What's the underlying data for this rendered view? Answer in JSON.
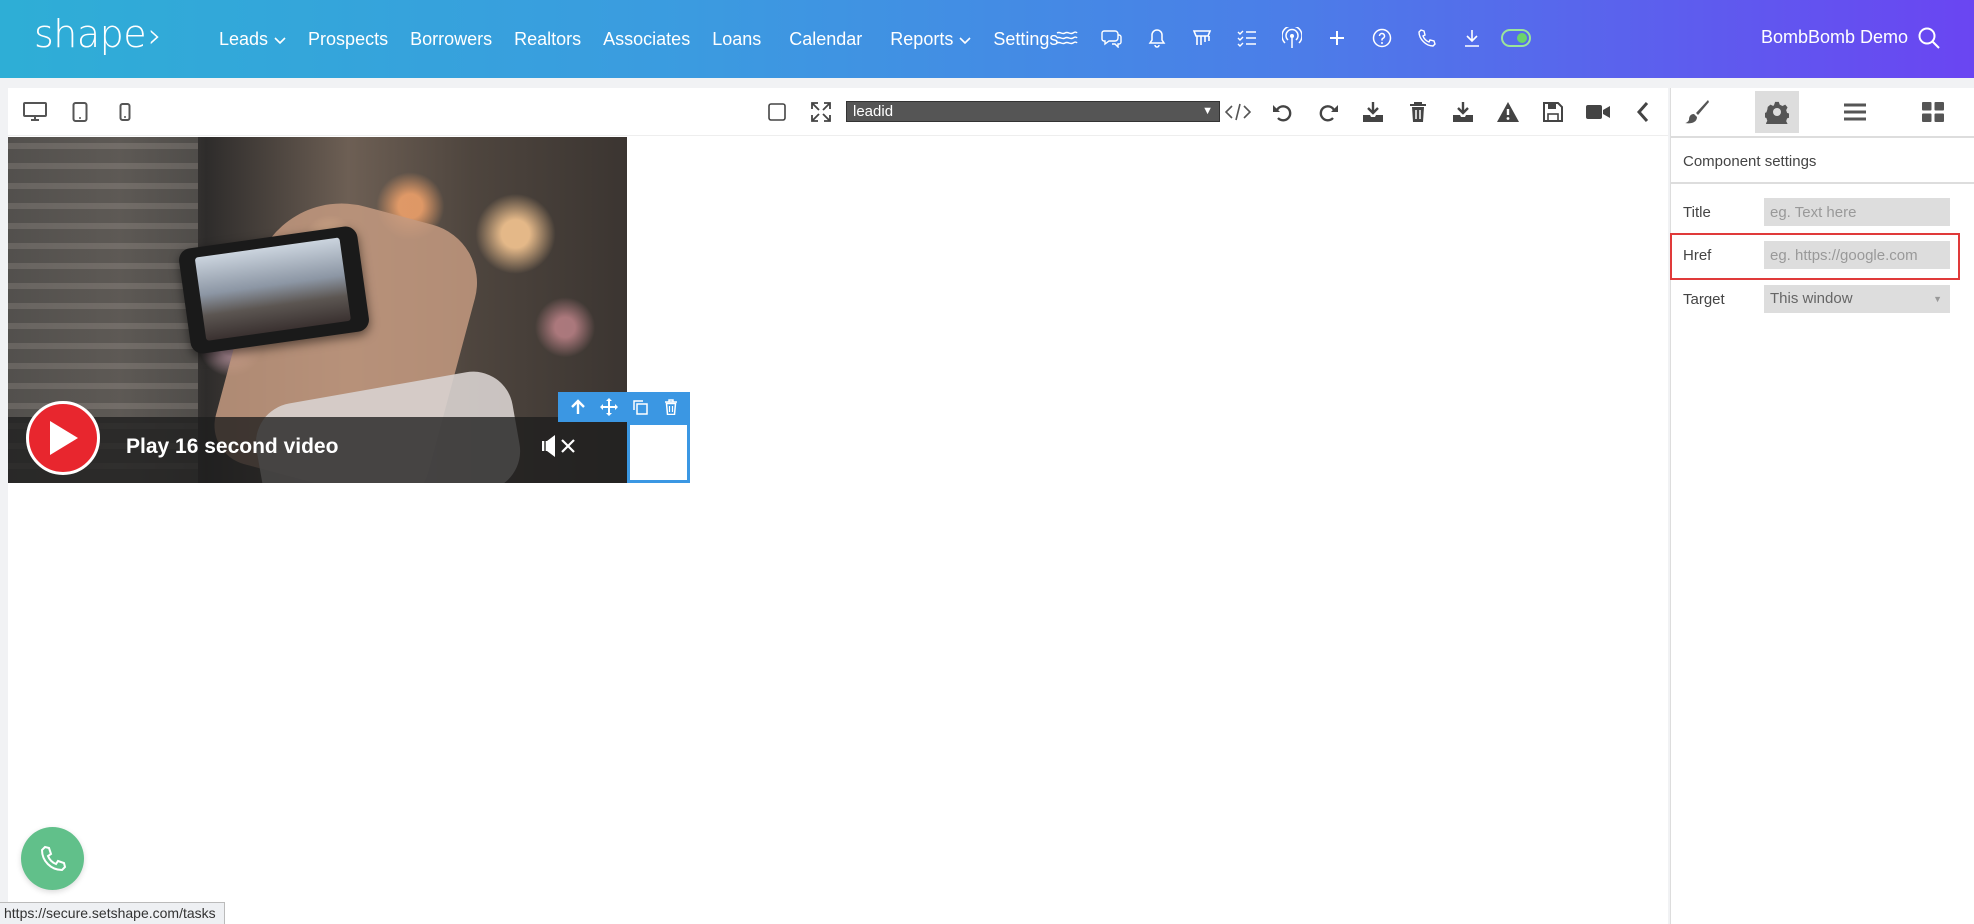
{
  "brand": {
    "logo_text": "shape",
    "logo_chevron": "›"
  },
  "nav": {
    "links": [
      {
        "label": "Leads",
        "dropdown": true
      },
      {
        "label": "Prospects",
        "dropdown": false
      },
      {
        "label": "Borrowers",
        "dropdown": false
      },
      {
        "label": "Realtors",
        "dropdown": false
      },
      {
        "label": "Associates",
        "dropdown": false
      },
      {
        "label": "Loans",
        "dropdown": false
      },
      {
        "label": "Calendar",
        "dropdown": false
      },
      {
        "label": "Reports",
        "dropdown": true
      },
      {
        "label": "Settings",
        "dropdown": false
      }
    ],
    "icons": [
      "menu-lines-icon",
      "chat-icon",
      "bell-icon",
      "store-icon",
      "checklist-icon",
      "broadcast-icon",
      "plus-icon",
      "help-icon",
      "phone-icon",
      "download-icon",
      "toggle-switch"
    ],
    "user_name": "BombBomb Demo"
  },
  "toolbar": {
    "device_icons": [
      "desktop-icon",
      "tablet-icon",
      "mobile-icon"
    ],
    "lead_select_value": "leadid",
    "action_icons": [
      "code-icon",
      "undo-icon",
      "redo-icon",
      "import-icon",
      "trash-icon",
      "export-icon",
      "warning-icon",
      "save-icon",
      "video-icon",
      "collapse-icon"
    ]
  },
  "video": {
    "title": "Play 16 second video"
  },
  "panel": {
    "heading": "Component settings",
    "fields": [
      {
        "label": "Title",
        "placeholder": "eg. Text here"
      },
      {
        "label": "Href",
        "placeholder": "eg. https://google.com"
      },
      {
        "label": "Target",
        "value": "This window"
      }
    ]
  },
  "status_url": "https://secure.setshape.com/tasks",
  "colors": {
    "accent": "#3b97e3",
    "play_red": "#e8262e",
    "fab_green": "#61c08a",
    "highlight_red": "#e03a3a"
  }
}
